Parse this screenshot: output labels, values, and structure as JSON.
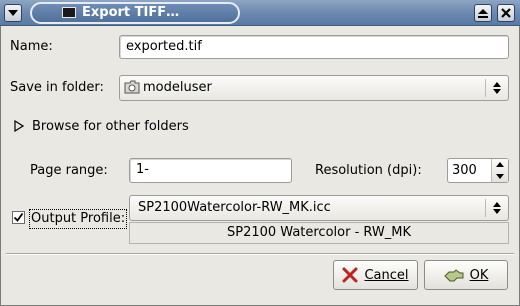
{
  "window": {
    "title": "Export TIFF…"
  },
  "form": {
    "name_label": "Name:",
    "name_value": "exported.tif",
    "folder_label": "Save in folder:",
    "folder_value": "modeluser",
    "browse_label": "Browse for other folders",
    "page_range_label": "Page range:",
    "page_range_value": "1-",
    "resolution_label": "Resolution (dpi):",
    "resolution_value": "300",
    "output_profile_label": "Output Profile:",
    "output_profile_checked": true,
    "output_profile_value": "SP2100Watercolor-RW_MK.icc",
    "profile_description": "SP2100 Watercolor - RW_MK"
  },
  "buttons": {
    "cancel": "Cancel",
    "ok": "OK"
  }
}
